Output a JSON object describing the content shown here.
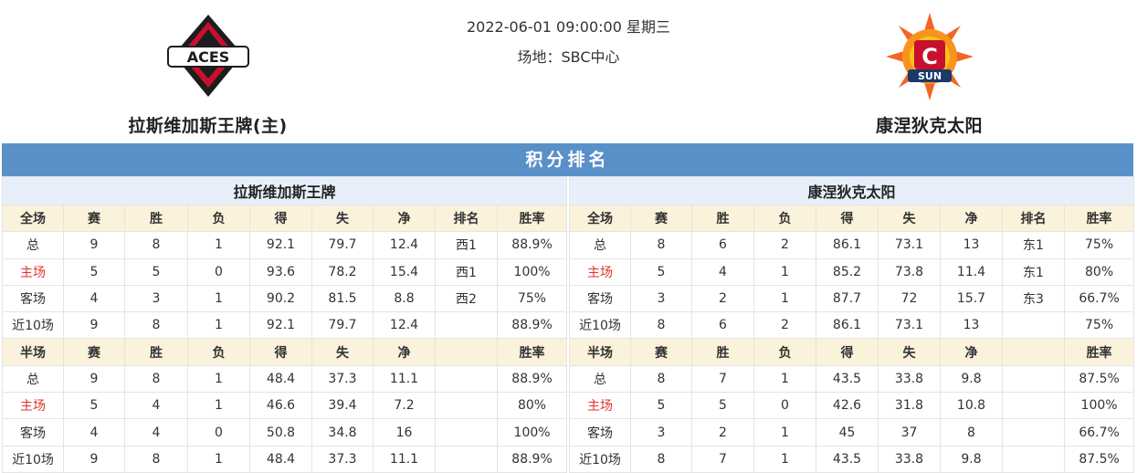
{
  "match": {
    "datetime": "2022-06-01 09:00:00 星期三",
    "venue": "场地：SBC中心"
  },
  "home_team": {
    "name": "拉斯维加斯王牌(主)",
    "logo": "aces-logo",
    "logo_text": "ACES"
  },
  "away_team": {
    "name": "康涅狄克太阳",
    "logo": "sun-logo",
    "logo_text": "SUN"
  },
  "section_title": "积分排名",
  "colors": {
    "title_bar": "#5a90c8",
    "header_bg": "#fbf2dc",
    "team_bg": "#e7f0fa",
    "home_label": "#e0332e"
  },
  "standings": {
    "left": {
      "team": "拉斯维加斯王牌",
      "full_header": [
        "全场",
        "赛",
        "胜",
        "负",
        "得",
        "失",
        "净",
        "排名",
        "胜率"
      ],
      "full_rows": [
        [
          "总",
          "9",
          "8",
          "1",
          "92.1",
          "79.7",
          "12.4",
          "西1",
          "88.9%"
        ],
        [
          "主场",
          "5",
          "5",
          "0",
          "93.6",
          "78.2",
          "15.4",
          "西1",
          "100%"
        ],
        [
          "客场",
          "4",
          "3",
          "1",
          "90.2",
          "81.5",
          "8.8",
          "西2",
          "75%"
        ],
        [
          "近10场",
          "9",
          "8",
          "1",
          "92.1",
          "79.7",
          "12.4",
          "",
          "88.9%"
        ]
      ],
      "half_header": [
        "半场",
        "赛",
        "胜",
        "负",
        "得",
        "失",
        "净",
        "",
        "胜率"
      ],
      "half_rows": [
        [
          "总",
          "9",
          "8",
          "1",
          "48.4",
          "37.3",
          "11.1",
          "",
          "88.9%"
        ],
        [
          "主场",
          "5",
          "4",
          "1",
          "46.6",
          "39.4",
          "7.2",
          "",
          "80%"
        ],
        [
          "客场",
          "4",
          "4",
          "0",
          "50.8",
          "34.8",
          "16",
          "",
          "100%"
        ],
        [
          "近10场",
          "9",
          "8",
          "1",
          "48.4",
          "37.3",
          "11.1",
          "",
          "88.9%"
        ]
      ]
    },
    "right": {
      "team": "康涅狄克太阳",
      "full_header": [
        "全场",
        "赛",
        "胜",
        "负",
        "得",
        "失",
        "净",
        "排名",
        "胜率"
      ],
      "full_rows": [
        [
          "总",
          "8",
          "6",
          "2",
          "86.1",
          "73.1",
          "13",
          "东1",
          "75%"
        ],
        [
          "主场",
          "5",
          "4",
          "1",
          "85.2",
          "73.8",
          "11.4",
          "东1",
          "80%"
        ],
        [
          "客场",
          "3",
          "2",
          "1",
          "87.7",
          "72",
          "15.7",
          "东3",
          "66.7%"
        ],
        [
          "近10场",
          "8",
          "6",
          "2",
          "86.1",
          "73.1",
          "13",
          "",
          "75%"
        ]
      ],
      "half_header": [
        "半场",
        "赛",
        "胜",
        "负",
        "得",
        "失",
        "净",
        "",
        "胜率"
      ],
      "half_rows": [
        [
          "总",
          "8",
          "7",
          "1",
          "43.5",
          "33.8",
          "9.8",
          "",
          "87.5%"
        ],
        [
          "主场",
          "5",
          "5",
          "0",
          "42.6",
          "31.8",
          "10.8",
          "",
          "100%"
        ],
        [
          "客场",
          "3",
          "2",
          "1",
          "45",
          "37",
          "8",
          "",
          "66.7%"
        ],
        [
          "近10场",
          "8",
          "7",
          "1",
          "43.5",
          "33.8",
          "9.8",
          "",
          "87.5%"
        ]
      ]
    }
  }
}
